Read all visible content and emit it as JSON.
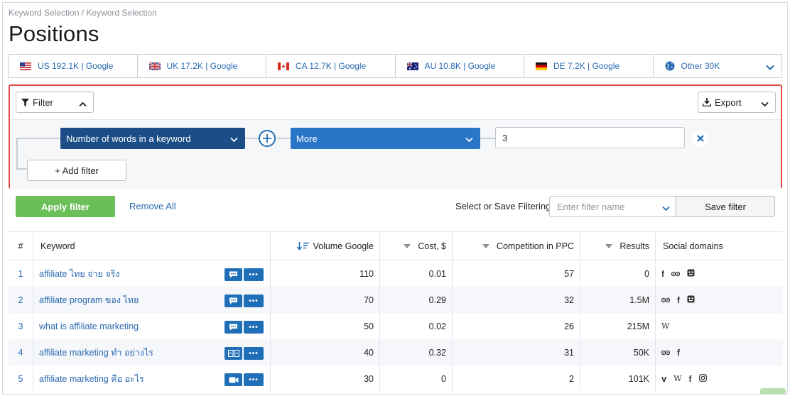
{
  "breadcrumb": "Keyword Selection / Keyword Selection",
  "title": "Positions",
  "db_tabs": [
    {
      "label": "US 192.1K | Google",
      "flag": "us"
    },
    {
      "label": "UK 17.2K | Google",
      "flag": "uk"
    },
    {
      "label": "CA 12.7K | Google",
      "flag": "ca"
    },
    {
      "label": "AU 10.8K | Google",
      "flag": "au"
    },
    {
      "label": "DE 7.2K | Google",
      "flag": "de"
    },
    {
      "label": "Other 30K",
      "flag": "globe"
    }
  ],
  "filter_panel": {
    "filter_label": "Filter",
    "export_label": "Export",
    "condition": "Number of words in a keyword",
    "operator": "More",
    "value": "3",
    "add_filter_label": "+ Add filter"
  },
  "actions": {
    "apply_label": "Apply filter",
    "remove_all_label": "Remove All",
    "save_prompt": "Select or Save Filtering:",
    "filter_name_placeholder": "Enter filter name",
    "save_filter_label": "Save filter"
  },
  "table": {
    "headers": {
      "num": "#",
      "keyword": "Keyword",
      "volume": "Volume Google",
      "cost": "Cost, $",
      "competition": "Competition in PPC",
      "results": "Results",
      "social": "Social domains"
    },
    "rows": [
      {
        "num": "1",
        "keyword": "affiliate ไทย จ่าย จริง",
        "volume": "110",
        "cost": "0.01",
        "competition": "57",
        "results": "0"
      },
      {
        "num": "2",
        "keyword": "affiliate program ของ ไทย",
        "volume": "70",
        "cost": "0.29",
        "competition": "32",
        "results": "1.5M"
      },
      {
        "num": "3",
        "keyword": "what is affiliate marketing",
        "volume": "50",
        "cost": "0.02",
        "competition": "26",
        "results": "215M"
      },
      {
        "num": "4",
        "keyword": "affiliate marketing ทำ อย่างไร",
        "volume": "40",
        "cost": "0.32",
        "competition": "31",
        "results": "50K"
      },
      {
        "num": "5",
        "keyword": "affiliate marketing คือ อะไร",
        "volume": "30",
        "cost": "0",
        "competition": "2",
        "results": "101K"
      }
    ]
  },
  "colors": {
    "accent_blue": "#2b6ab0",
    "dark_blue": "#1b4e86",
    "apply_green": "#6bbf59",
    "panel_border_red": "#e34a4a"
  }
}
